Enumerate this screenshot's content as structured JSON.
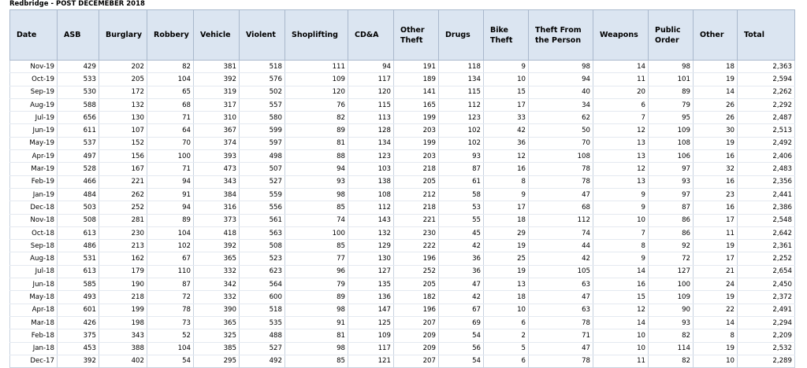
{
  "title": "Redbridge - POST DECEMEBER 2018",
  "columns": [
    "Date",
    "ASB",
    "Burglary",
    "Robbery",
    "Vehicle",
    "Violent",
    "Shoplifting",
    "CD&A",
    "Other Theft",
    "Drugs",
    "Bike Theft",
    "Theft From the Person",
    "Weapons",
    "Public Order",
    "Other",
    "Total"
  ],
  "rows": [
    [
      "Nov-19",
      "429",
      "202",
      "82",
      "381",
      "518",
      "111",
      "94",
      "191",
      "118",
      "9",
      "98",
      "14",
      "98",
      "18",
      "2,363"
    ],
    [
      "Oct-19",
      "533",
      "205",
      "104",
      "392",
      "576",
      "109",
      "117",
      "189",
      "134",
      "10",
      "94",
      "11",
      "101",
      "19",
      "2,594"
    ],
    [
      "Sep-19",
      "530",
      "172",
      "65",
      "319",
      "502",
      "120",
      "120",
      "141",
      "115",
      "15",
      "40",
      "20",
      "89",
      "14",
      "2,262"
    ],
    [
      "Aug-19",
      "588",
      "132",
      "68",
      "317",
      "557",
      "76",
      "115",
      "165",
      "112",
      "17",
      "34",
      "6",
      "79",
      "26",
      "2,292"
    ],
    [
      "Jul-19",
      "656",
      "130",
      "71",
      "310",
      "580",
      "82",
      "113",
      "199",
      "123",
      "33",
      "62",
      "7",
      "95",
      "26",
      "2,487"
    ],
    [
      "Jun-19",
      "611",
      "107",
      "64",
      "367",
      "599",
      "89",
      "128",
      "203",
      "102",
      "42",
      "50",
      "12",
      "109",
      "30",
      "2,513"
    ],
    [
      "May-19",
      "537",
      "152",
      "70",
      "374",
      "597",
      "81",
      "134",
      "199",
      "102",
      "36",
      "70",
      "13",
      "108",
      "19",
      "2,492"
    ],
    [
      "Apr-19",
      "497",
      "156",
      "100",
      "393",
      "498",
      "88",
      "123",
      "203",
      "93",
      "12",
      "108",
      "13",
      "106",
      "16",
      "2,406"
    ],
    [
      "Mar-19",
      "528",
      "167",
      "71",
      "473",
      "507",
      "94",
      "103",
      "218",
      "87",
      "16",
      "78",
      "12",
      "97",
      "32",
      "2,483"
    ],
    [
      "Feb-19",
      "466",
      "221",
      "94",
      "343",
      "527",
      "93",
      "138",
      "205",
      "61",
      "8",
      "78",
      "13",
      "93",
      "16",
      "2,356"
    ],
    [
      "Jan-19",
      "484",
      "262",
      "91",
      "384",
      "559",
      "98",
      "108",
      "212",
      "58",
      "9",
      "47",
      "9",
      "97",
      "23",
      "2,441"
    ],
    [
      "Dec-18",
      "503",
      "252",
      "94",
      "316",
      "556",
      "85",
      "112",
      "218",
      "53",
      "17",
      "68",
      "9",
      "87",
      "16",
      "2,386"
    ],
    [
      "Nov-18",
      "508",
      "281",
      "89",
      "373",
      "561",
      "74",
      "143",
      "221",
      "55",
      "18",
      "112",
      "10",
      "86",
      "17",
      "2,548"
    ],
    [
      "Oct-18",
      "613",
      "230",
      "104",
      "418",
      "563",
      "100",
      "132",
      "230",
      "45",
      "29",
      "74",
      "7",
      "86",
      "11",
      "2,642"
    ],
    [
      "Sep-18",
      "486",
      "213",
      "102",
      "392",
      "508",
      "85",
      "129",
      "222",
      "42",
      "19",
      "44",
      "8",
      "92",
      "19",
      "2,361"
    ],
    [
      "Aug-18",
      "531",
      "162",
      "67",
      "365",
      "523",
      "77",
      "130",
      "196",
      "36",
      "25",
      "42",
      "9",
      "72",
      "17",
      "2,252"
    ],
    [
      "Jul-18",
      "613",
      "179",
      "110",
      "332",
      "623",
      "96",
      "127",
      "252",
      "36",
      "19",
      "105",
      "14",
      "127",
      "21",
      "2,654"
    ],
    [
      "Jun-18",
      "585",
      "190",
      "87",
      "342",
      "564",
      "79",
      "135",
      "205",
      "47",
      "13",
      "63",
      "16",
      "100",
      "24",
      "2,450"
    ],
    [
      "May-18",
      "493",
      "218",
      "72",
      "332",
      "600",
      "89",
      "136",
      "182",
      "42",
      "18",
      "47",
      "15",
      "109",
      "19",
      "2,372"
    ],
    [
      "Apr-18",
      "601",
      "199",
      "78",
      "390",
      "518",
      "98",
      "147",
      "196",
      "67",
      "10",
      "63",
      "12",
      "90",
      "22",
      "2,491"
    ],
    [
      "Mar-18",
      "426",
      "198",
      "73",
      "365",
      "535",
      "91",
      "125",
      "207",
      "69",
      "6",
      "78",
      "14",
      "93",
      "14",
      "2,294"
    ],
    [
      "Feb-18",
      "375",
      "343",
      "52",
      "325",
      "488",
      "81",
      "109",
      "209",
      "54",
      "2",
      "71",
      "10",
      "82",
      "8",
      "2,209"
    ],
    [
      "Jan-18",
      "453",
      "388",
      "104",
      "385",
      "527",
      "98",
      "117",
      "209",
      "56",
      "5",
      "47",
      "10",
      "114",
      "19",
      "2,532"
    ],
    [
      "Dec-17",
      "392",
      "402",
      "54",
      "295",
      "492",
      "85",
      "121",
      "207",
      "54",
      "6",
      "78",
      "11",
      "82",
      "10",
      "2,289"
    ]
  ]
}
